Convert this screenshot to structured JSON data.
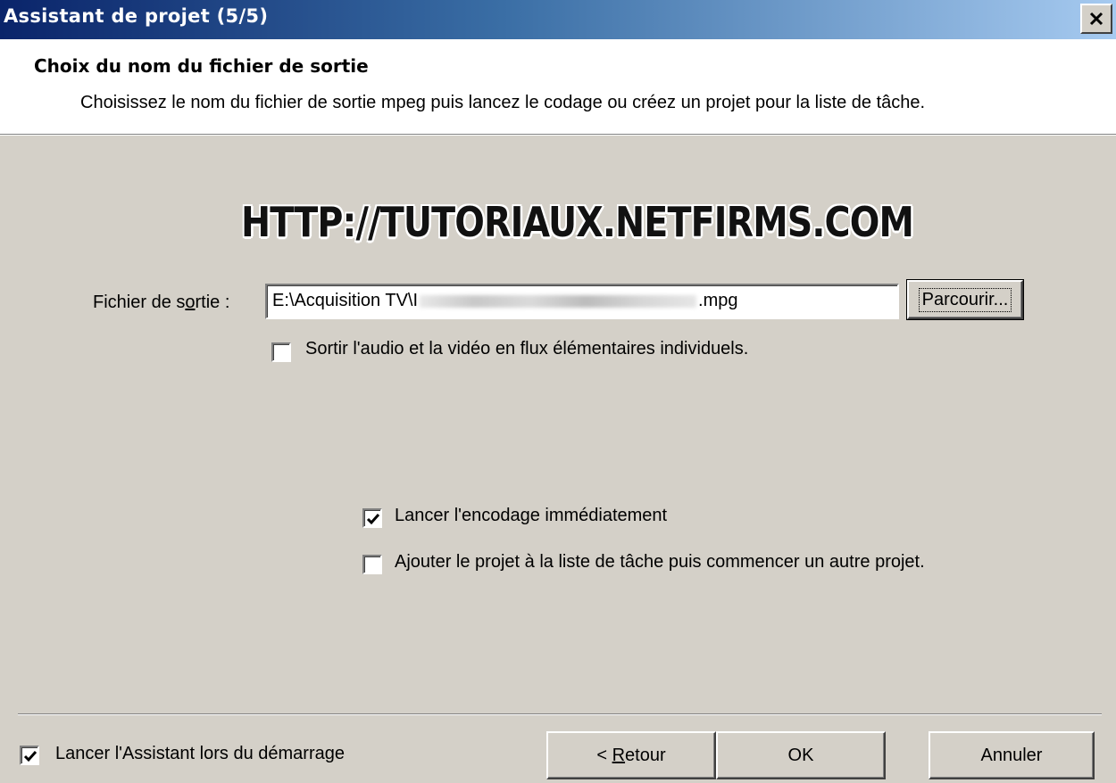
{
  "window": {
    "title": "Assistant de projet (5/5)",
    "close_icon": "close-icon"
  },
  "header": {
    "title": "Choix du nom du fichier de sortie",
    "subtitle": "Choisissez le nom du fichier de sortie mpeg puis lancez le codage ou créez un projet pour la liste de tâche."
  },
  "banner": {
    "text": "HTTP://TUTORIAUX.NETFIRMS.COM"
  },
  "output": {
    "label_pre": "Fichier de s",
    "label_accel": "o",
    "label_post": "rtie :",
    "path_prefix": "E:\\Acquisition TV\\I",
    "path_suffix": ".mpg",
    "browse_label": "Parcourir..."
  },
  "options": {
    "elementary_streams": {
      "label": "Sortir l'audio et la vidéo en flux élémentaires individuels.",
      "checked": false
    },
    "encode_now": {
      "label": "Lancer l'encodage immédiatement",
      "checked": true
    },
    "add_to_list": {
      "label": "Ajouter le projet à la liste de tâche puis commencer un autre projet.",
      "checked": false
    }
  },
  "footer": {
    "startup_wizard": {
      "label": "Lancer l'Assistant lors du démarrage",
      "checked": true
    },
    "back_prefix": "< ",
    "back_accel": "R",
    "back_rest": "etour",
    "ok_label": "OK",
    "cancel_label": "Annuler"
  }
}
